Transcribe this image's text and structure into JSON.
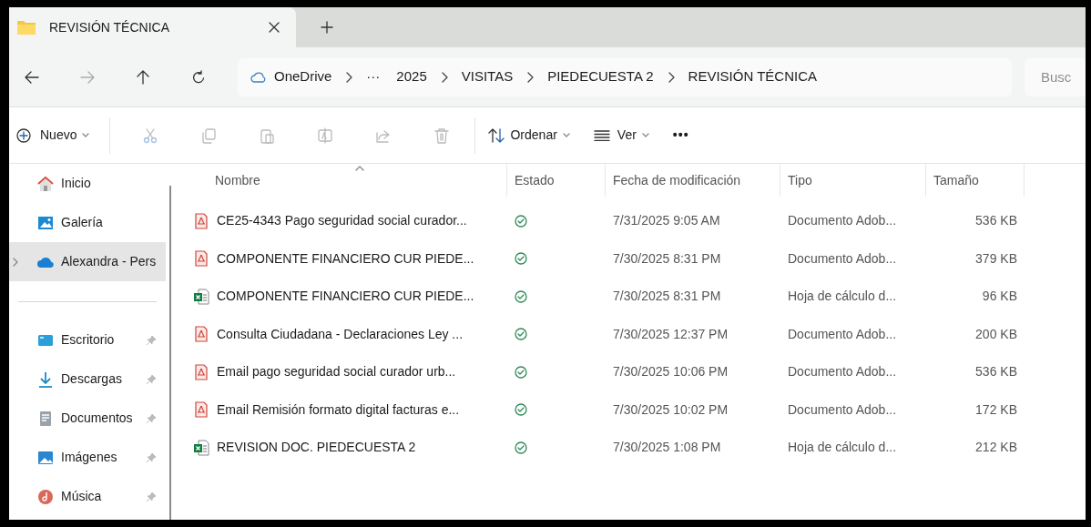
{
  "tab": {
    "title": "REVISIÓN TÉCNICA",
    "selected": true
  },
  "breadcrumb": [
    "OneDrive",
    "···",
    "2025",
    "VISITAS",
    "PIEDECUESTA 2",
    "REVISIÓN TÉCNICA"
  ],
  "search": {
    "placeholder": "Busc"
  },
  "toolbar": {
    "new_label": "Nuevo",
    "sort_label": "Ordenar",
    "view_label": "Ver",
    "more": "•••"
  },
  "sidebar": {
    "items": [
      {
        "label": "Inicio",
        "kind": "home",
        "pinned": false,
        "selected": false
      },
      {
        "label": "Galería",
        "kind": "gallery",
        "pinned": false,
        "selected": false
      },
      {
        "label": "Alexandra - Pers",
        "kind": "cloud",
        "pinned": false,
        "selected": true
      },
      {
        "label": "Escritorio",
        "kind": "desktop",
        "pinned": true,
        "selected": false
      },
      {
        "label": "Descargas",
        "kind": "downloads",
        "pinned": true,
        "selected": false
      },
      {
        "label": "Documentos",
        "kind": "documents",
        "pinned": true,
        "selected": false
      },
      {
        "label": "Imágenes",
        "kind": "images",
        "pinned": true,
        "selected": false
      },
      {
        "label": "Música",
        "kind": "music",
        "pinned": true,
        "selected": false
      }
    ]
  },
  "table": {
    "columns": [
      "Nombre",
      "Estado",
      "Fecha de modificación",
      "Tipo",
      "Tamaño"
    ],
    "rows": [
      {
        "kind": "pdf",
        "name": "CE25-4343 Pago seguridad social curador...",
        "date": "7/31/2025 9:05 AM",
        "type": "Documento Adob...",
        "size": "536 KB"
      },
      {
        "kind": "pdf",
        "name": "COMPONENTE FINANCIERO CUR PIEDE...",
        "date": "7/30/2025 8:31 PM",
        "type": "Documento Adob...",
        "size": "379 KB"
      },
      {
        "kind": "excel",
        "name": "COMPONENTE FINANCIERO CUR PIEDE...",
        "date": "7/30/2025 8:31 PM",
        "type": "Hoja de cálculo d...",
        "size": "96 KB"
      },
      {
        "kind": "pdf",
        "name": "Consulta Ciudadana - Declaraciones Ley ...",
        "date": "7/30/2025 12:37 PM",
        "type": "Documento Adob...",
        "size": "200 KB"
      },
      {
        "kind": "pdf",
        "name": "Email pago seguridad social curador urb...",
        "date": "7/30/2025 10:06 PM",
        "type": "Documento Adob...",
        "size": "536 KB"
      },
      {
        "kind": "pdf",
        "name": "Email Remisión formato digital facturas e...",
        "date": "7/30/2025 10:02 PM",
        "type": "Documento Adob...",
        "size": "172 KB"
      },
      {
        "kind": "excel",
        "name": "REVISION DOC. PIEDECUESTA 2",
        "date": "7/30/2025 1:08 PM",
        "type": "Hoja de cálculo d...",
        "size": "212 KB"
      }
    ]
  }
}
